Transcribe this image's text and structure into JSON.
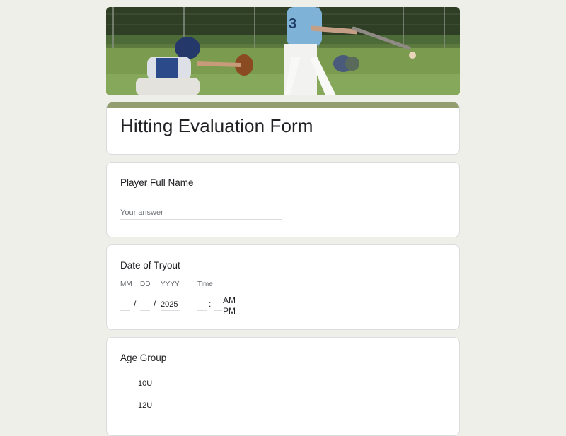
{
  "form": {
    "title": "Hitting Evaluation Form"
  },
  "questions": {
    "player_name": {
      "label": "Player Full Name",
      "placeholder": "Your answer"
    },
    "date_of_tryout": {
      "label": "Date of Tryout",
      "mm_label": "MM",
      "dd_label": "DD",
      "yyyy_label": "YYYY",
      "time_label": "Time",
      "year_value": "2025",
      "date_sep1": "/",
      "date_sep2": "/",
      "time_sep": ":",
      "am": "AM",
      "pm": "PM"
    },
    "age_group": {
      "label": "Age Group",
      "options": [
        "10U",
        "12U"
      ]
    }
  },
  "colors": {
    "page_bg": "#efefe9",
    "accent": "#929d70"
  },
  "icons": [
    "banner-image"
  ]
}
